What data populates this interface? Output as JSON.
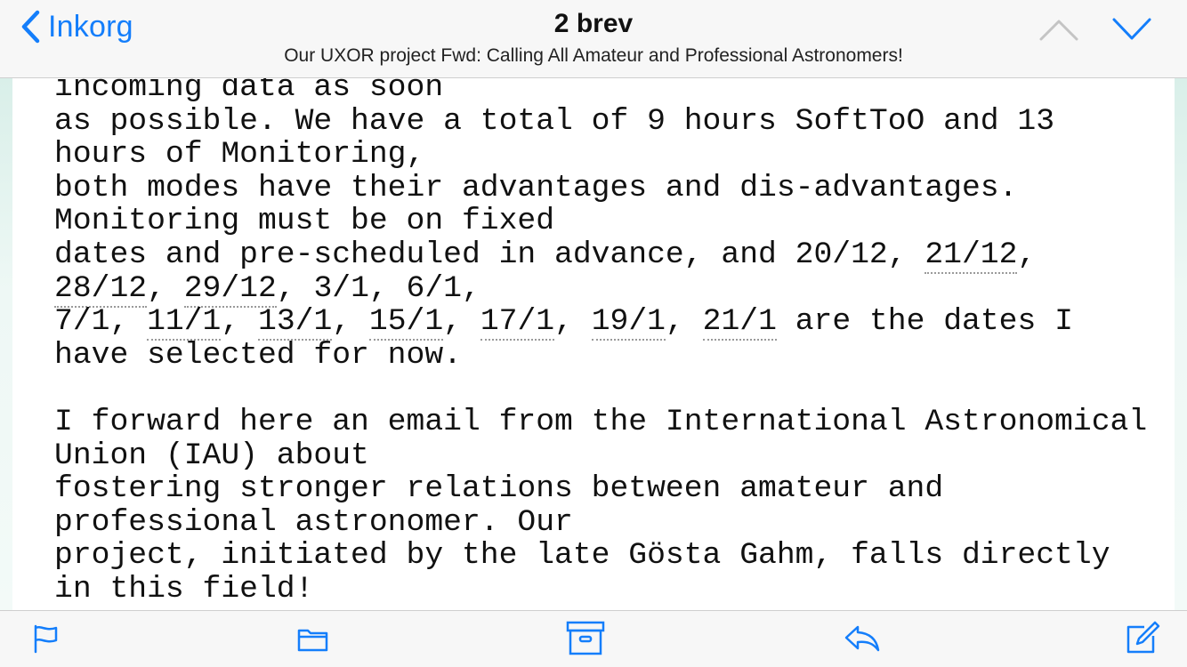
{
  "navbar": {
    "back_label": "Inkorg",
    "title": "2 brev",
    "subtitle": "Our UXOR project Fwd: Calling All Amateur and Professional Astronomers!",
    "accent_color": "#147efb",
    "icons": {
      "back": "chevron-left-icon",
      "prev": "chevron-up-icon",
      "next": "chevron-down-icon"
    }
  },
  "message": {
    "lines": [
      [
        {
          "t": "incoming data as soon"
        }
      ],
      [
        {
          "t": "as possible. We have a total of 9 hours SoftToO and 13"
        }
      ],
      [
        {
          "t": "hours of Monitoring,"
        }
      ],
      [
        {
          "t": "both modes have their advantages and dis-advantages."
        }
      ],
      [
        {
          "t": "Monitoring must be on fixed"
        }
      ],
      [
        {
          "t": "dates and pre-scheduled in advance, and 20/12, "
        },
        {
          "t": "21/12",
          "link": true
        },
        {
          "t": ","
        }
      ],
      [
        {
          "t": "28/12",
          "link": true
        },
        {
          "t": ", "
        },
        {
          "t": "29/12",
          "link": true
        },
        {
          "t": ", 3/1, 6/1,"
        }
      ],
      [
        {
          "t": "7/1, "
        },
        {
          "t": "11/1",
          "link": true
        },
        {
          "t": ", "
        },
        {
          "t": "13/1",
          "link": true
        },
        {
          "t": ", "
        },
        {
          "t": "15/1",
          "link": true
        },
        {
          "t": ", "
        },
        {
          "t": "17/1",
          "link": true
        },
        {
          "t": ", "
        },
        {
          "t": "19/1",
          "link": true
        },
        {
          "t": ", "
        },
        {
          "t": "21/1",
          "link": true
        },
        {
          "t": " are the dates I"
        }
      ],
      [
        {
          "t": "have selected for now."
        }
      ],
      [
        {
          "t": ""
        }
      ],
      [
        {
          "t": "I forward here an email from the International Astronomical"
        }
      ],
      [
        {
          "t": "Union (IAU) about"
        }
      ],
      [
        {
          "t": "fostering stronger relations between amateur and"
        }
      ],
      [
        {
          "t": "professional astronomer. Our"
        }
      ],
      [
        {
          "t": "project, initiated by the late Gösta Gahm, falls directly"
        }
      ],
      [
        {
          "t": "in this field!"
        }
      ]
    ]
  },
  "toolbar": {
    "icons": [
      "flag-icon",
      "folder-icon",
      "archive-icon",
      "reply-icon",
      "compose-icon"
    ]
  }
}
